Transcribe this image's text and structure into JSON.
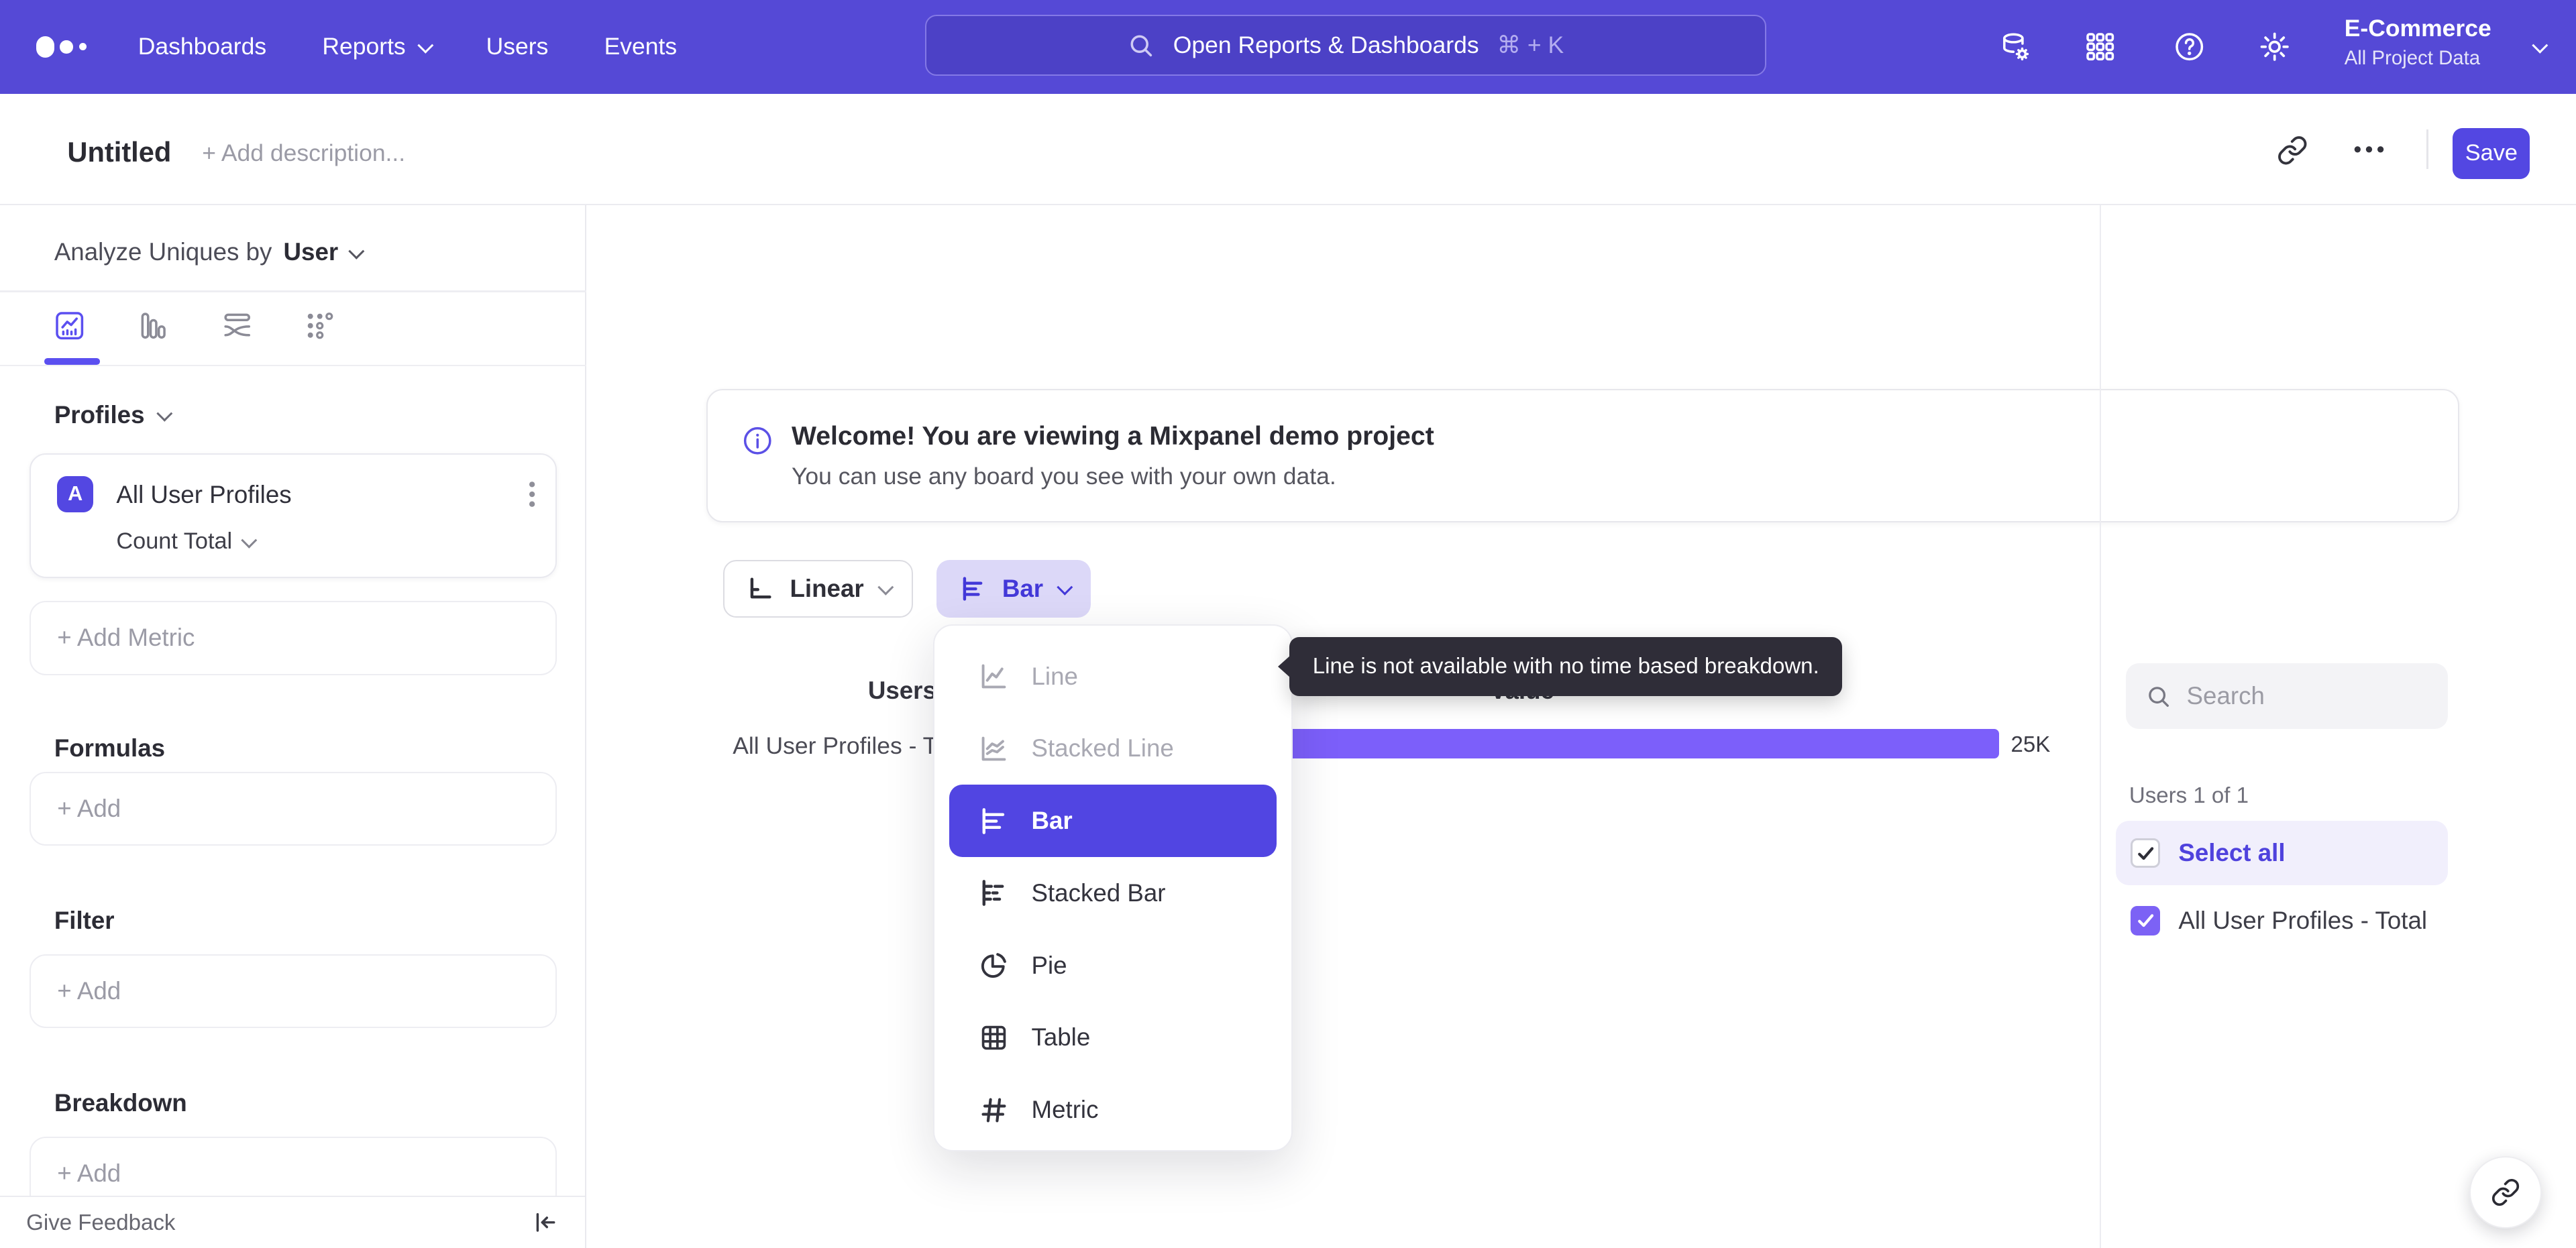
{
  "nav": {
    "links": [
      {
        "label": "Dashboards"
      },
      {
        "label": "Reports"
      },
      {
        "label": "Users"
      },
      {
        "label": "Events"
      }
    ],
    "search": {
      "placeholder": "Open Reports & Dashboards",
      "shortcut": "⌘ + K"
    },
    "icons": [
      "data-connections-icon",
      "apps-grid-icon",
      "help-icon",
      "settings-gear-icon"
    ],
    "project": {
      "name": "E-Commerce",
      "scope": "All Project Data"
    }
  },
  "titlebar": {
    "title": "Untitled",
    "description_placeholder": "+ Add description...",
    "save_label": "Save",
    "icons": [
      "copy-link-icon",
      "more-ellipsis-icon"
    ]
  },
  "sidebar": {
    "analyze_prefix": "Analyze Uniques by",
    "analyze_value": "User",
    "tabs": [
      "insights-tab",
      "bar-tab",
      "flows-tab",
      "retention-tab"
    ],
    "profiles_label": "Profiles",
    "metric_card": {
      "badge": "A",
      "name": "All User Profiles",
      "aggregation": "Count Total"
    },
    "add_metric_label": "+ Add Metric",
    "formulas_label": "Formulas",
    "formulas_add": "+ Add",
    "filter_label": "Filter",
    "filter_add": "+ Add",
    "breakdown_label": "Breakdown",
    "breakdown_add": "+ Add",
    "feedback_label": "Give Feedback"
  },
  "banner": {
    "title": "Welcome! You are viewing a Mixpanel demo project",
    "subtitle": "You can use any board you see with your own data."
  },
  "controls": {
    "scale_label": "Linear",
    "chart_type_label": "Bar"
  },
  "chart_menu": {
    "items": [
      {
        "label": "Line",
        "state": "disabled"
      },
      {
        "label": "Stacked Line",
        "state": "disabled"
      },
      {
        "label": "Bar",
        "state": "selected"
      },
      {
        "label": "Stacked Bar",
        "state": "enabled"
      },
      {
        "label": "Pie",
        "state": "enabled"
      },
      {
        "label": "Table",
        "state": "enabled"
      },
      {
        "label": "Metric",
        "state": "enabled"
      }
    ]
  },
  "tooltip": {
    "text": "Line is not available with no time based breakdown."
  },
  "chart": {
    "header_users": "Users",
    "header_value": "Value",
    "row_label": "All User Profiles - Total",
    "value_label": "25K"
  },
  "chart_data": {
    "type": "bar",
    "orientation": "horizontal",
    "columns": [
      "Users",
      "Value"
    ],
    "categories": [
      "All User Profiles - Total"
    ],
    "values": [
      25000
    ],
    "value_labels": [
      "25K"
    ],
    "bar_color": "#7c5ffa",
    "grid": false,
    "legend": false
  },
  "right_panel": {
    "search_placeholder": "Search",
    "count_label": "Users 1 of 1",
    "select_all_label": "Select all",
    "items": [
      {
        "label": "All User Profiles - Total",
        "checked": true
      }
    ]
  },
  "colors": {
    "nav_bg": "#5549d6",
    "accent": "#5347e2",
    "bar_fill": "#7c5ffa",
    "checkbox_fill": "#7c62f5",
    "tooltip_bg": "#2f2d38",
    "chip_bg": "#dcd8f8"
  }
}
